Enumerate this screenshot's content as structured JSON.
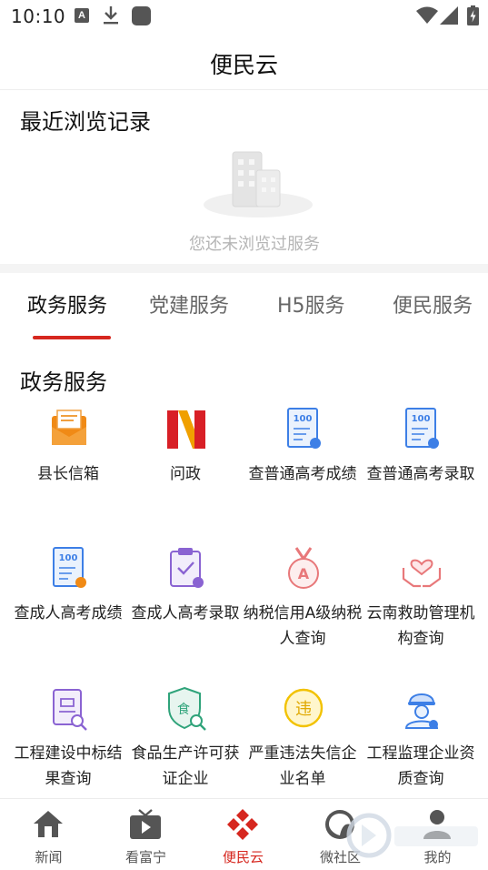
{
  "status_bar": {
    "time": "10:10",
    "a_badge": "A",
    "icons": [
      "notification-a-icon",
      "download-icon",
      "app-square-icon",
      "wifi-icon",
      "signal-icon",
      "battery-charging-icon"
    ]
  },
  "header": {
    "title": "便民云"
  },
  "recent": {
    "title": "最近浏览记录",
    "empty_text": "您还未浏览过服务",
    "empty_icon": "buildings-illustration-icon"
  },
  "tabs": [
    {
      "label": "政务服务",
      "active": true
    },
    {
      "label": "党建服务",
      "active": false
    },
    {
      "label": "H5服务",
      "active": false
    },
    {
      "label": "便民服务",
      "active": false
    }
  ],
  "section": {
    "title": "政务服务",
    "items": [
      {
        "label": "县长信箱",
        "icon": "mailbox-icon"
      },
      {
        "label": "问政",
        "icon": "n-logo-icon"
      },
      {
        "label": "查普通高考成绩",
        "icon": "score-report-icon",
        "badge": "100"
      },
      {
        "label": "查普通高考录取",
        "icon": "admission-report-icon",
        "badge": "100"
      },
      {
        "label": "查成人高考成绩",
        "icon": "adult-score-icon",
        "badge": "100"
      },
      {
        "label": "查成人高考录取",
        "icon": "clipboard-check-icon"
      },
      {
        "label": "纳税信用A级纳税人查询",
        "icon": "a-medal-icon"
      },
      {
        "label": "云南救助管理机构查询",
        "icon": "heart-hands-icon"
      },
      {
        "label": "工程建设中标结果查询",
        "icon": "tender-search-icon"
      },
      {
        "label": "食品生产许可获证企业",
        "icon": "food-shield-icon",
        "badge": "食"
      },
      {
        "label": "严重违法失信企业名单",
        "icon": "violation-badge-icon",
        "badge": "违"
      },
      {
        "label": "工程监理企业资质查询",
        "icon": "engineer-helmet-icon"
      }
    ]
  },
  "bottom_nav": [
    {
      "label": "新闻",
      "icon": "home-icon",
      "active": false
    },
    {
      "label": "看富宁",
      "icon": "tv-play-icon",
      "active": false
    },
    {
      "label": "便民云",
      "icon": "diamond-cluster-icon",
      "active": true
    },
    {
      "label": "微社区",
      "icon": "community-icon",
      "active": false
    },
    {
      "label": "我的",
      "icon": "user-icon",
      "active": false
    }
  ],
  "colors": {
    "accent": "#d6271f",
    "blue": "#3d7fe6",
    "purple": "#8a63d2",
    "pink": "#e8787a",
    "green": "#2fa37a",
    "yellow": "#f2c200",
    "orange": "#f08a16"
  }
}
